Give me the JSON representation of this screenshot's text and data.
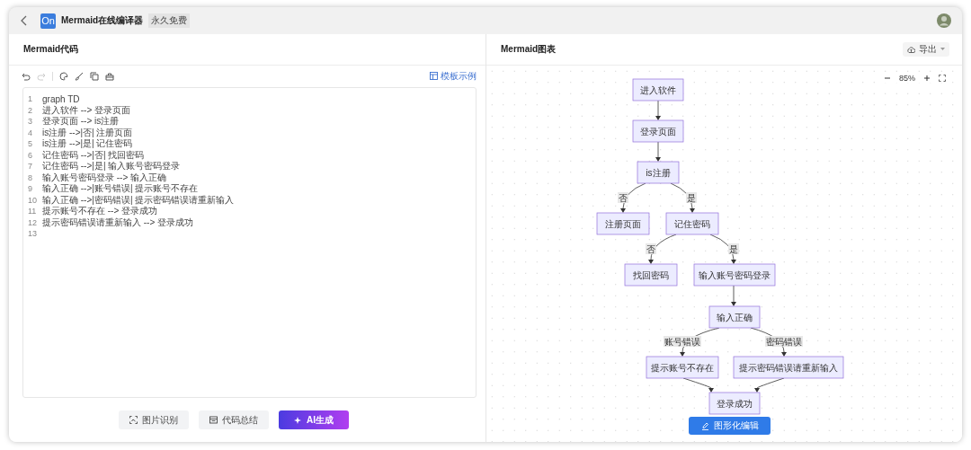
{
  "app": {
    "logo": "On",
    "title": "Mermaid在线编译器",
    "badge": "永久免费"
  },
  "code_panel": {
    "title": "Mermaid代码",
    "tools": [
      {
        "kind": "undo",
        "disabled": false
      },
      {
        "kind": "redo",
        "disabled": true
      },
      {
        "kind": "palette",
        "disabled": false
      },
      {
        "kind": "brush",
        "disabled": false
      },
      {
        "kind": "copy",
        "disabled": false
      },
      {
        "kind": "clear",
        "disabled": false
      }
    ],
    "template_link": "模板示例",
    "lines": [
      {
        "number": "1",
        "text": "graph TD"
      },
      {
        "number": "2",
        "text": "进入软件 --> 登录页面"
      },
      {
        "number": "3",
        "text": "登录页面 --> is注册"
      },
      {
        "number": "4",
        "text": "is注册 -->|否| 注册页面"
      },
      {
        "number": "5",
        "text": "is注册 -->|是| 记住密码"
      },
      {
        "number": "6",
        "text": "记住密码 -->|否| 找回密码"
      },
      {
        "number": "7",
        "text": "记住密码 -->|是| 输入账号密码登录"
      },
      {
        "number": "8",
        "text": "输入账号密码登录 --> 输入正确"
      },
      {
        "number": "9",
        "text": "输入正确 -->|账号错误| 提示账号不存在"
      },
      {
        "number": "10",
        "text": "输入正确 -->|密码错误| 提示密码错误请重新输入"
      },
      {
        "number": "11",
        "text": "提示账号不存在 --> 登录成功"
      },
      {
        "number": "12",
        "text": "提示密码错误请重新输入 --> 登录成功"
      },
      {
        "number": "13"
      }
    ],
    "buttons": [
      {
        "label": "图片识别",
        "kind": "image"
      },
      {
        "label": "代码总结",
        "kind": "summary"
      },
      {
        "label": "AI生成",
        "kind": "ai"
      }
    ]
  },
  "chart_panel": {
    "title": "Mermaid图表",
    "export": "导出",
    "zoom": "85%",
    "nodes": [
      "进入软件",
      "登录页面",
      "is注册",
      "注册页面",
      "记住密码",
      "找回密码",
      "输入账号密码登录",
      "输入正确",
      "提示账号不存在",
      "提示密码错误请重新输入",
      "登录成功"
    ],
    "edge_labels": [
      "否",
      "是",
      "否",
      "是",
      "账号错误",
      "密码错误"
    ],
    "edit_button": "图形化编辑"
  }
}
